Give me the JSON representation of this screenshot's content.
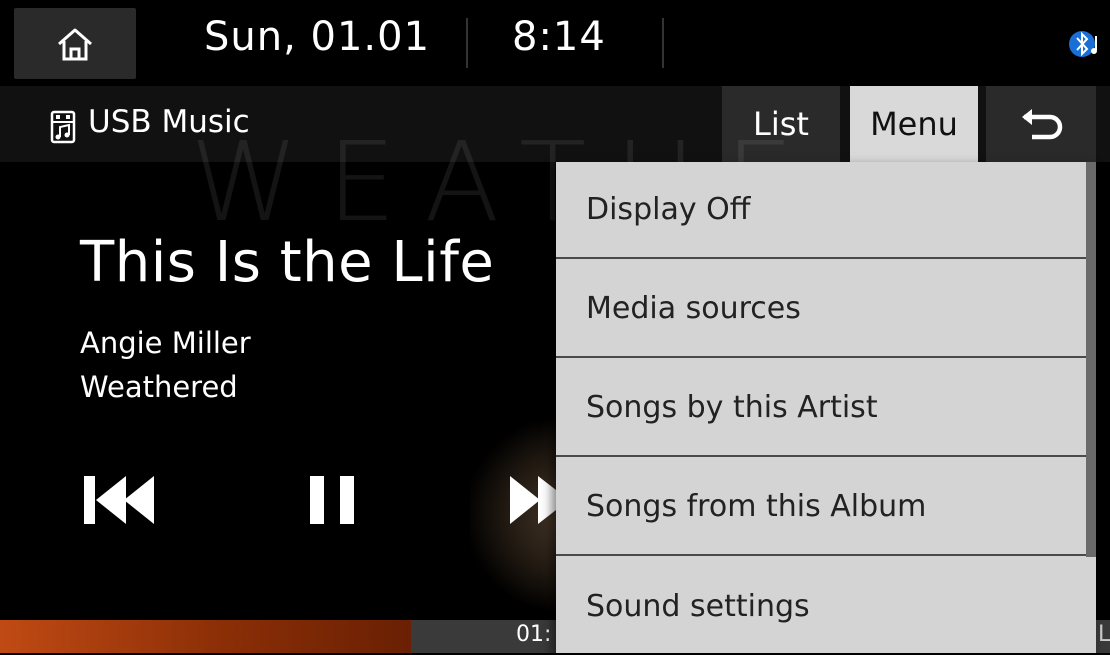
{
  "status_bar": {
    "date": "Sun, 01.01",
    "time": "8:14",
    "bluetooth_icon": "bluetooth-music-icon",
    "home_icon": "home-icon"
  },
  "header": {
    "source_icon": "usb-music-icon",
    "source_label": "USB Music",
    "list_label": "List",
    "menu_label": "Menu",
    "back_icon": "back-arrow-icon"
  },
  "player": {
    "title": "This Is the Life",
    "artist": "Angie Miller",
    "album": "Weathered",
    "watermark": "WEATHE",
    "elapsed": "01:",
    "end_label": "L",
    "progress": 0.37,
    "controls": [
      "previous-track-icon",
      "pause-icon",
      "next-track-icon"
    ]
  },
  "menu": {
    "items": [
      {
        "label": "Display Off"
      },
      {
        "label": "Media sources"
      },
      {
        "label": "Songs by this Artist"
      },
      {
        "label": "Songs from this Album"
      },
      {
        "label": "Sound settings"
      }
    ]
  },
  "colors": {
    "progress_fill": "#c04a14",
    "menu_bg": "#d4d4d4",
    "menu_active": "#d9d9d9",
    "bluetooth": "#1a6fd6"
  }
}
